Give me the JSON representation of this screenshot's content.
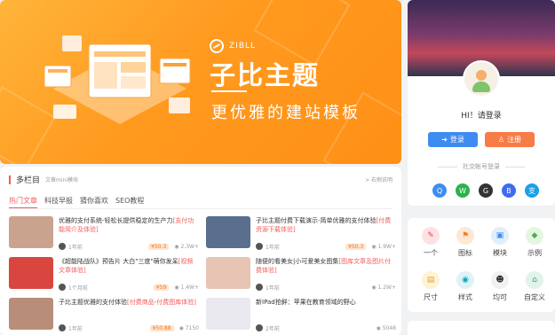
{
  "banner": {
    "logo_text": "ZIBLL",
    "title": "子比主题",
    "subtitle": "更优雅的建站模板"
  },
  "sidebar": {
    "greeting": "HI！请登录",
    "login": "登录",
    "register": "注册",
    "social_label": "社交帐号登录",
    "social_icons": [
      {
        "name": "qq-icon",
        "glyph": "Q",
        "color": "#3e8cf0"
      },
      {
        "name": "wechat-icon",
        "glyph": "W",
        "color": "#2bb24c"
      },
      {
        "name": "github-icon",
        "glyph": "G",
        "color": "#333333"
      },
      {
        "name": "baidu-icon",
        "glyph": "B",
        "color": "#3e6cf0"
      },
      {
        "name": "alipay-icon",
        "glyph": "支",
        "color": "#1aa0e8"
      }
    ],
    "icon_items": [
      {
        "label": "一个",
        "glyph": "✎",
        "color": "#fde2e4",
        "fg": "#e84a5f"
      },
      {
        "label": "图标",
        "glyph": "⚑",
        "color": "#fde8d4",
        "fg": "#f07a24"
      },
      {
        "label": "模块",
        "glyph": "▣",
        "color": "#e1eefc",
        "fg": "#3e8cf0"
      },
      {
        "label": "示例",
        "glyph": "◆",
        "color": "#e4f6e0",
        "fg": "#4caf50"
      },
      {
        "label": "尺寸",
        "glyph": "▤",
        "color": "#fff3d6",
        "fg": "#e6a23c"
      },
      {
        "label": "样式",
        "glyph": "◉",
        "color": "#dff3f7",
        "fg": "#1aa0b8"
      },
      {
        "label": "均可",
        "glyph": "☻",
        "color": "#f1f1f1",
        "fg": "#333333"
      },
      {
        "label": "自定义",
        "glyph": "⌂",
        "color": "#e1f3ea",
        "fg": "#27ae60"
      }
    ]
  },
  "main": {
    "section_title": "多栏目",
    "section_sub": "文章mini模块",
    "more": "> 右侧说明",
    "tabs": [
      "热门文章",
      "科技早报",
      "猜你喜欢",
      "SEO教程"
    ],
    "posts": [
      {
        "title": "优雅的支付系统-轻松长提供稳定的生产力",
        "hl": "[支付功能简介及体验]",
        "time": "1年前",
        "price": "¥50.3",
        "views": "2.3W+",
        "thumb": "#c9a38e"
      },
      {
        "title": "子比主题付费下载演示-简单优雅的支付体验",
        "hl": "[付费资源下载体验]",
        "time": "1年前",
        "price": "¥50.3",
        "views": "1.9W+",
        "thumb": "#5a6f8e"
      },
      {
        "title": "《超能陆战队》预告片 大白\"三度\"萌你发呆",
        "hl": "[视频文章体验]",
        "time": "1个月前",
        "price": "¥59",
        "views": "1.4W+",
        "thumb": "#d9463f"
      },
      {
        "title": "随便的看美女|小可爱美女图集",
        "hl": "[图库文章及图片付费体验]",
        "time": "1年前",
        "price": "",
        "views": "1.2W+",
        "thumb": "#e8c4b4"
      },
      {
        "title": "子比主题优雅的支付体验",
        "hl": "[付费商品-付费图库体验]",
        "time": "1年前",
        "price": "¥50.88",
        "views": "7150",
        "thumb": "#b88e7a"
      },
      {
        "title": "新IPad抢鲜：苹果在教育领域的野心",
        "hl": "",
        "time": "2年前",
        "price": "",
        "views": "5048",
        "thumb": "#e9e9ef"
      }
    ]
  }
}
